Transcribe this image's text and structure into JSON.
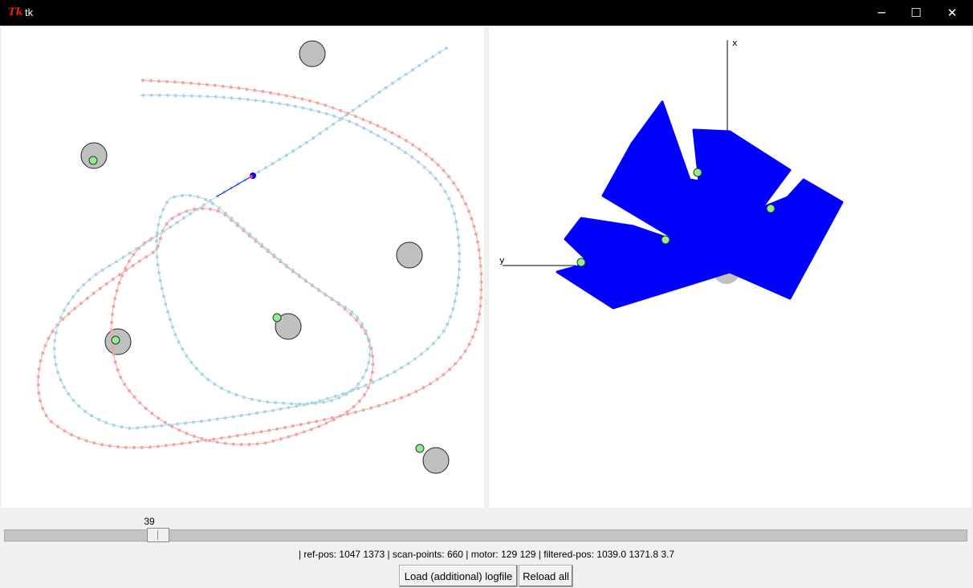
{
  "window": {
    "title": "tk",
    "logo_text": "Tk",
    "minimize_glyph": "─",
    "maximize_glyph": "☐",
    "close_glyph": "✕"
  },
  "icons": {
    "logo": "tk-feather-icon",
    "minimize": "minimize-icon",
    "maximize": "maximize-icon",
    "close": "close-icon"
  },
  "colors": {
    "trajectory_reference": "#f4a3a3",
    "trajectory_filtered": "#a8d4e6",
    "scan": "#0000ff",
    "landmark_fill": "#c0c0c0",
    "detected_landmark": "#90ee90"
  },
  "scan_view": {
    "axis_x_label": "x",
    "axis_y_label": "y"
  },
  "slider": {
    "value": 39,
    "value_text": "39",
    "fraction": 0.148
  },
  "status": {
    "text": "| ref-pos: 1047 1373 | scan-points: 660 | motor: 129 129 | filtered-pos: 1039.0 1371.8 3.7"
  },
  "buttons": {
    "load_label": "Load (additional) logfile",
    "reload_label": "Reload all"
  }
}
